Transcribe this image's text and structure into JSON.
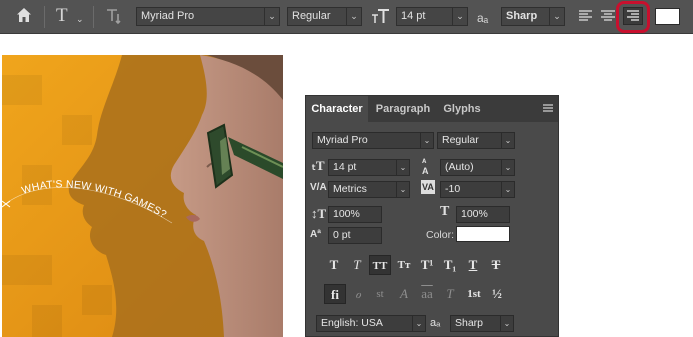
{
  "options_bar": {
    "font_family": "Myriad Pro",
    "font_style": "Regular",
    "font_size": "14 pt",
    "aa_label": "aₐ",
    "anti_alias": "Sharp",
    "text_color": "#ffffff",
    "highlight_color": "#c8102e"
  },
  "canvas": {
    "curved_text": "WHAT'S NEW WITH GAMES?"
  },
  "panel": {
    "tabs": [
      "Character",
      "Paragraph",
      "Glyphs"
    ],
    "font_family": "Myriad Pro",
    "font_style": "Regular",
    "font_size": "14 pt",
    "leading": "(Auto)",
    "kerning": "Metrics",
    "tracking": "-10",
    "vertical_scale": "100%",
    "horizontal_scale": "100%",
    "baseline_shift": "0 pt",
    "color_label": "Color:",
    "language": "English: USA",
    "aa_label": "aₐ",
    "anti_alias": "Sharp",
    "style_buttons": [
      "T",
      "T",
      "TT",
      "Tт",
      "T¹",
      "T₁",
      "T",
      "T"
    ],
    "opentype_buttons": [
      "fi",
      "ℴ",
      "st",
      "A",
      "aa",
      "T",
      "1st",
      "½"
    ]
  }
}
